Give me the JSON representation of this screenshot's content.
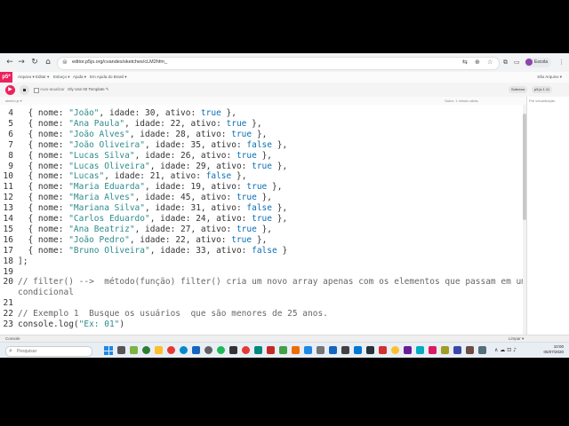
{
  "browser": {
    "url": "editor.p5js.org/cvandes/sketches/cLM2hfm_",
    "profile_label": "Escola"
  },
  "p5": {
    "logo": "p5*",
    "menu": [
      "Arquivo ▾",
      "Editar ▾",
      "Esboço ▾",
      "Ajuda ▾",
      "Em Ajuda do Brasil ▾"
    ],
    "language": "São Arquivo ▾",
    "autorun_label": "Auto-atualizar",
    "sketch_name": "Oly Use 00 Template ✎",
    "settings_label": "Sobreca",
    "version_label": "p5.js 1.11",
    "file_label": "sketch.js ▾",
    "saved_label": "Salvo: 1 minuto atrás",
    "preview_label": "Pré-visualização",
    "console_label": "Console",
    "console_clear": "Limpar ▾"
  },
  "editor": {
    "lines": [
      {
        "n": "4",
        "segs": [
          [
            "p",
            "  { nome: "
          ],
          [
            "s",
            "\"João\""
          ],
          [
            "p",
            ", idade: 30, ativo: "
          ],
          [
            "k",
            "true"
          ],
          [
            "p",
            " },"
          ]
        ]
      },
      {
        "n": "5",
        "segs": [
          [
            "p",
            "  { nome: "
          ],
          [
            "s",
            "\"Ana Paula\""
          ],
          [
            "p",
            ", idade: 22, ativo: "
          ],
          [
            "k",
            "true"
          ],
          [
            "p",
            " },"
          ]
        ]
      },
      {
        "n": "6",
        "segs": [
          [
            "p",
            "  { nome: "
          ],
          [
            "s",
            "\"João Alves\""
          ],
          [
            "p",
            ", idade: 28, ativo: "
          ],
          [
            "k",
            "true"
          ],
          [
            "p",
            " },"
          ]
        ]
      },
      {
        "n": "7",
        "segs": [
          [
            "p",
            "  { nome: "
          ],
          [
            "s",
            "\"João Oliveira\""
          ],
          [
            "p",
            ", idade: 35, ativo: "
          ],
          [
            "k",
            "false"
          ],
          [
            "p",
            " },"
          ]
        ]
      },
      {
        "n": "8",
        "segs": [
          [
            "p",
            "  { nome: "
          ],
          [
            "s",
            "\"Lucas Silva\""
          ],
          [
            "p",
            ", idade: 26, ativo: "
          ],
          [
            "k",
            "true"
          ],
          [
            "p",
            " },"
          ]
        ]
      },
      {
        "n": "9",
        "segs": [
          [
            "p",
            "  { nome: "
          ],
          [
            "s",
            "\"Lucas Oliveira\""
          ],
          [
            "p",
            ", idade: 29, ativo: "
          ],
          [
            "k",
            "true"
          ],
          [
            "p",
            " },"
          ]
        ]
      },
      {
        "n": "10",
        "segs": [
          [
            "p",
            "  { nome: "
          ],
          [
            "s",
            "\"Lucas\""
          ],
          [
            "p",
            ", idade: 21, ativo: "
          ],
          [
            "k",
            "false"
          ],
          [
            "p",
            " },"
          ]
        ]
      },
      {
        "n": "11",
        "segs": [
          [
            "p",
            "  { nome: "
          ],
          [
            "s",
            "\"Maria Eduarda\""
          ],
          [
            "p",
            ", idade: 19, ativo: "
          ],
          [
            "k",
            "true"
          ],
          [
            "p",
            " },"
          ]
        ]
      },
      {
        "n": "12",
        "segs": [
          [
            "p",
            "  { nome: "
          ],
          [
            "s",
            "\"Maria Alves\""
          ],
          [
            "p",
            ", idade: 45, ativo: "
          ],
          [
            "k",
            "true"
          ],
          [
            "p",
            " },"
          ]
        ]
      },
      {
        "n": "13",
        "segs": [
          [
            "p",
            "  { nome: "
          ],
          [
            "s",
            "\"Mariana Silva\""
          ],
          [
            "p",
            ", idade: 31, ativo: "
          ],
          [
            "k",
            "false"
          ],
          [
            "p",
            " },"
          ]
        ]
      },
      {
        "n": "14",
        "segs": [
          [
            "p",
            "  { nome: "
          ],
          [
            "s",
            "\"Carlos Eduardo\""
          ],
          [
            "p",
            ", idade: 24, ativo: "
          ],
          [
            "k",
            "true"
          ],
          [
            "p",
            " },"
          ]
        ]
      },
      {
        "n": "15",
        "segs": [
          [
            "p",
            "  { nome: "
          ],
          [
            "s",
            "\"Ana Beatriz\""
          ],
          [
            "p",
            ", idade: 27, ativo: "
          ],
          [
            "k",
            "true"
          ],
          [
            "p",
            " },"
          ]
        ]
      },
      {
        "n": "16",
        "segs": [
          [
            "p",
            "  { nome: "
          ],
          [
            "s",
            "\"João Pedro\""
          ],
          [
            "p",
            ", idade: 22, ativo: "
          ],
          [
            "k",
            "true"
          ],
          [
            "p",
            " },"
          ]
        ]
      },
      {
        "n": "17",
        "segs": [
          [
            "p",
            "  { nome: "
          ],
          [
            "s",
            "\"Bruno Oliveira\""
          ],
          [
            "p",
            ", idade: 33, ativo: "
          ],
          [
            "k",
            "false"
          ],
          [
            "p",
            " }"
          ]
        ]
      },
      {
        "n": "18",
        "segs": [
          [
            "p",
            "];"
          ]
        ]
      },
      {
        "n": "19",
        "segs": []
      },
      {
        "n": "20",
        "segs": [
          [
            "c",
            "// filter() -->  método(função) filter() cria um novo array apenas com os elementos que passam em um teste"
          ]
        ]
      },
      {
        "n": "",
        "segs": [
          [
            "c",
            "condicional"
          ]
        ]
      },
      {
        "n": "21",
        "segs": []
      },
      {
        "n": "22",
        "segs": [
          [
            "c",
            "// Exemplo 1  Busque os usuários  que são menores de 25 anos."
          ]
        ]
      },
      {
        "n": "23",
        "segs": [
          [
            "p",
            "console.log("
          ],
          [
            "s",
            "\"Ex: 01\""
          ],
          [
            "p",
            ")"
          ]
        ]
      }
    ]
  },
  "taskbar": {
    "search_placeholder": "Pesquisar",
    "tray_text": "∧  ☁  ⊡  ♪",
    "time": "10:00",
    "date": "05/07/2020"
  },
  "colors": {
    "p5_pink": "#ed225d",
    "string": "#2e8b8b",
    "keyword": "#0b6fb3"
  }
}
